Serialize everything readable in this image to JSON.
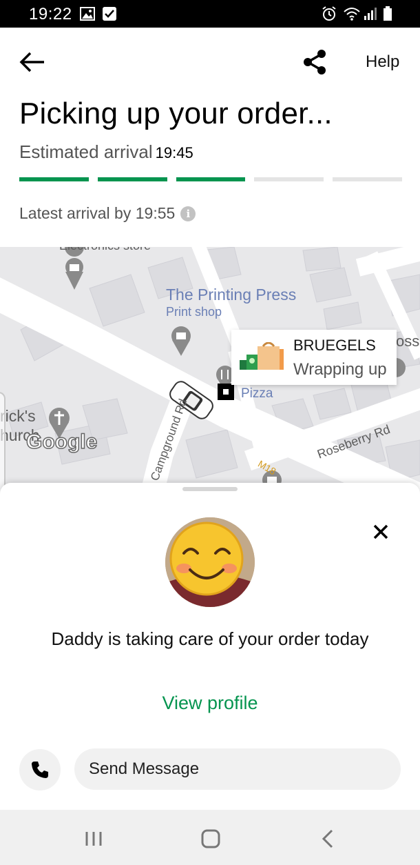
{
  "status_bar": {
    "time": "19:22",
    "left_icons": [
      "gallery-icon",
      "check-icon"
    ],
    "right_icons": [
      "alarm-icon",
      "wifi-icon",
      "signal-icon",
      "battery-icon"
    ]
  },
  "header": {
    "back_icon": "arrow-left-icon",
    "share_icon": "share-icon",
    "help_label": "Help"
  },
  "order": {
    "title": "Picking up your order...",
    "eta_label": "Estimated arrival",
    "eta_time": "19:45",
    "progress": {
      "total_steps": 5,
      "completed_steps": 3
    },
    "latest_arrival": "Latest arrival by 19:55",
    "info_icon": "info-icon"
  },
  "map": {
    "labels": {
      "top_store": "Electronics store",
      "print_name": "The Printing Press",
      "print_type": "Print shop",
      "pizza": "Pizza",
      "church_1": "rick's",
      "church_2": "hurch",
      "google": "Google",
      "road_1": "Campground Rd",
      "road_2": "Roseberry Rd",
      "road_3": "M18",
      "edge_text": "osse"
    },
    "store_card": {
      "name": "BRUEGELS",
      "status": "Wrapping up"
    },
    "colors": {
      "background": "#e8e8ea",
      "road": "#ffffff",
      "building": "#dcdce0"
    }
  },
  "courier": {
    "message": "Daddy is taking care of your order today",
    "view_profile": "View profile",
    "close_icon": "close-icon"
  },
  "contact": {
    "phone_icon": "phone-icon",
    "send_message": "Send Message"
  },
  "nav_bar": {
    "buttons": [
      "recents-icon",
      "home-icon",
      "back-icon"
    ]
  },
  "colors": {
    "accent": "#05944f",
    "progress_inactive": "#e4e4e4",
    "text_secondary": "#545454"
  }
}
